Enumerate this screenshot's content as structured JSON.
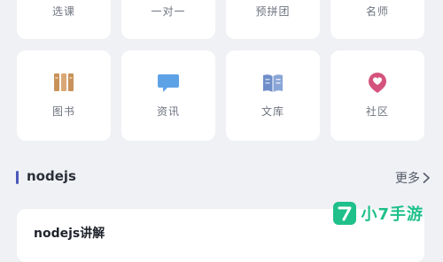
{
  "grid_row1": [
    {
      "label": "选课"
    },
    {
      "label": "一对一"
    },
    {
      "label": "预拼团"
    },
    {
      "label": "名师"
    }
  ],
  "grid_row2": [
    {
      "label": "图书",
      "icon": "books-icon",
      "color": "#c8925a"
    },
    {
      "label": "资讯",
      "icon": "chat-bubble-icon",
      "color": "#5ea2e6"
    },
    {
      "label": "文库",
      "icon": "open-book-icon",
      "color": "#6f8ec9"
    },
    {
      "label": "社区",
      "icon": "heart-pin-icon",
      "color": "#d4537c"
    }
  ],
  "section": {
    "title": "nodejs",
    "more_label": "更多"
  },
  "article": {
    "title": "nodejs讲解"
  },
  "watermark": {
    "text": "小7手游",
    "color": "#1fc08a"
  }
}
